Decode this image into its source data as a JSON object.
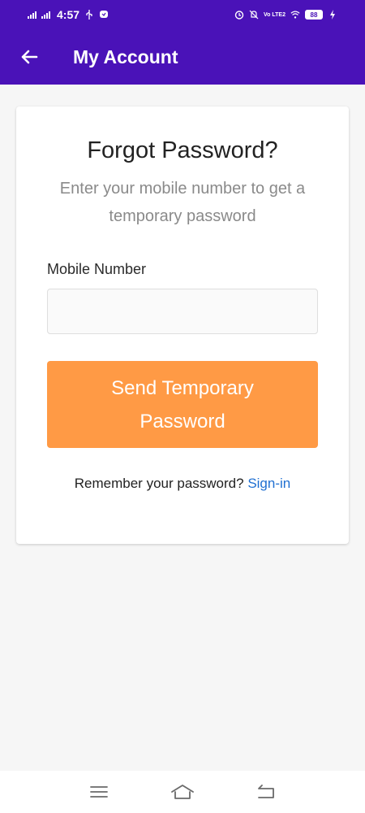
{
  "status_bar": {
    "time": "4:57",
    "network": "Vo LTE2",
    "battery": "88"
  },
  "app_bar": {
    "title": "My Account"
  },
  "card": {
    "title": "Forgot Password?",
    "subtitle": "Enter your mobile number to get a temporary password",
    "field_label": "Mobile Number",
    "input_value": "",
    "input_placeholder": "",
    "button_label": "Send Temporary Password",
    "remember_text": "Remember your password?",
    "signin_link": "Sign-in"
  },
  "colors": {
    "primary": "#4a12b8",
    "accent_button": "#ff9a45",
    "link": "#1f6fd1",
    "background": "#f6f6f6"
  },
  "icons": {
    "back": "arrow-left-icon",
    "nav_menu": "menu-icon",
    "nav_home": "home-icon",
    "nav_back": "back-icon"
  }
}
